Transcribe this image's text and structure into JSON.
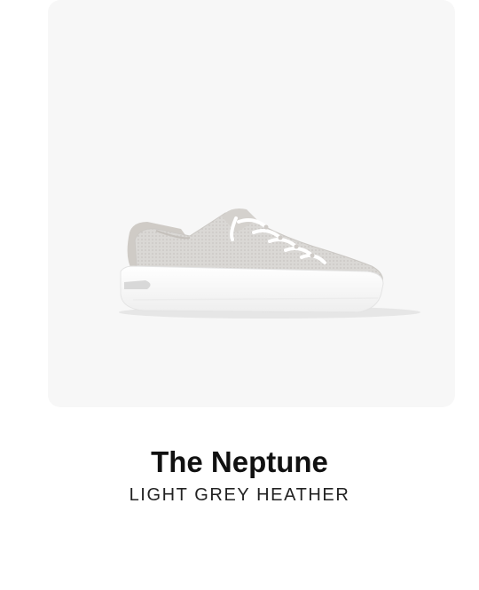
{
  "product": {
    "name": "The Neptune",
    "color": "LIGHT GREY HEATHER",
    "image_subject": "sneaker-icon"
  },
  "colors": {
    "panel_background": "#f7f7f7",
    "knit_upper": "#d9d7d4",
    "sole": "#ffffff",
    "text": "#111111"
  }
}
